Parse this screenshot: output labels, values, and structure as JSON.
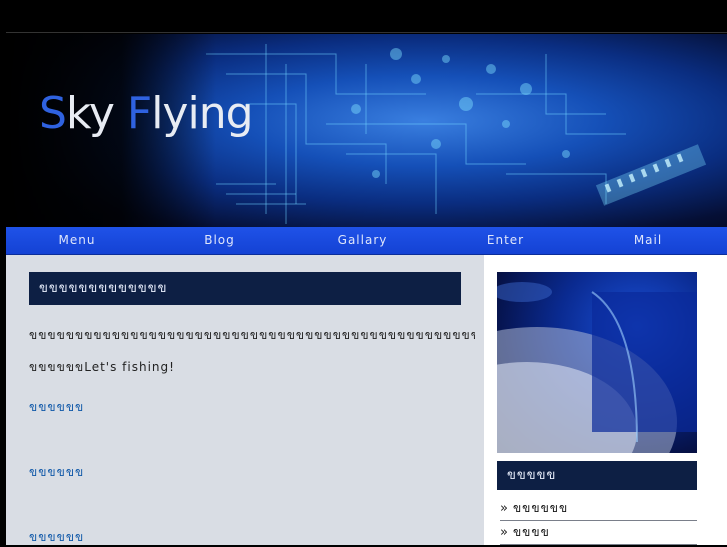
{
  "site": {
    "logo_first_letter_1": "S",
    "logo_rest_1": "ky",
    "logo_first_letter_2": "F",
    "logo_rest_2": "lying"
  },
  "nav": {
    "items": [
      {
        "label": "Menu"
      },
      {
        "label": "Blog"
      },
      {
        "label": "Gallary"
      },
      {
        "label": "Enter"
      },
      {
        "label": "Mail"
      }
    ]
  },
  "main": {
    "title": "ขขขขขขขขขขขขข",
    "paragraph_line1": "ขขขขขขขขขขขขขขขขขขขขขขขขขขขขขขขขขขขขขขขขขขขขขขขขขขขขขขขขข",
    "paragraph_line2_prefix": "ขขขขขข",
    "paragraph_line2_suffix": "Let's fishing!",
    "links": [
      "ขขขขขข",
      "ขขขขขข",
      "ขขขขขข"
    ]
  },
  "sidebar": {
    "title": "ขขขขข",
    "items": [
      {
        "label": "ขขขขขข",
        "icon": "double-chevron-right-icon"
      },
      {
        "label": "ขขขข",
        "icon": "double-chevron-right-icon"
      }
    ]
  },
  "colors": {
    "nav_bg": "#1f52e8",
    "title_bg": "#0d1f44",
    "content_bg": "#d9dde4",
    "link": "#0e57a8",
    "logo_accent": "#2f62e0"
  }
}
